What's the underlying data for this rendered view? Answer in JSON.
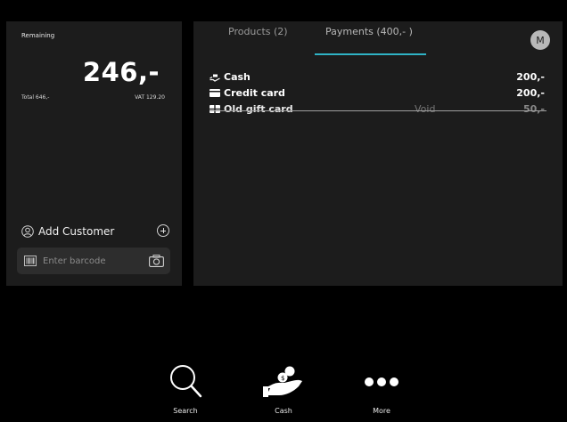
{
  "summary": {
    "remaining_label": "Remaining",
    "amount": "246,-",
    "total": "Total 646,-",
    "vat": "VAT 129.20"
  },
  "customer": {
    "add_label": "Add Customer",
    "barcode_placeholder": "Enter barcode"
  },
  "tabs": [
    {
      "label": "Products (2)"
    },
    {
      "label": "Payments (400,- )",
      "active": true
    }
  ],
  "avatar": "M",
  "payments": [
    {
      "icon": "cash-icon",
      "name": "Cash",
      "amount": "200,-"
    },
    {
      "icon": "credit-card-icon",
      "name": "Credit card",
      "amount": "200,-"
    },
    {
      "icon": "gift-card-icon",
      "name": "Old gift card",
      "status": "Void",
      "amount": "50,-"
    }
  ],
  "bottom_nav": [
    {
      "icon": "search-icon",
      "label": "Search"
    },
    {
      "icon": "cash-hand-icon",
      "label": "Cash"
    },
    {
      "icon": "more-icon",
      "label": "More"
    }
  ],
  "colors": {
    "accent": "#2fb3c5",
    "panel": "#1c1c1c",
    "background": "#000000"
  }
}
